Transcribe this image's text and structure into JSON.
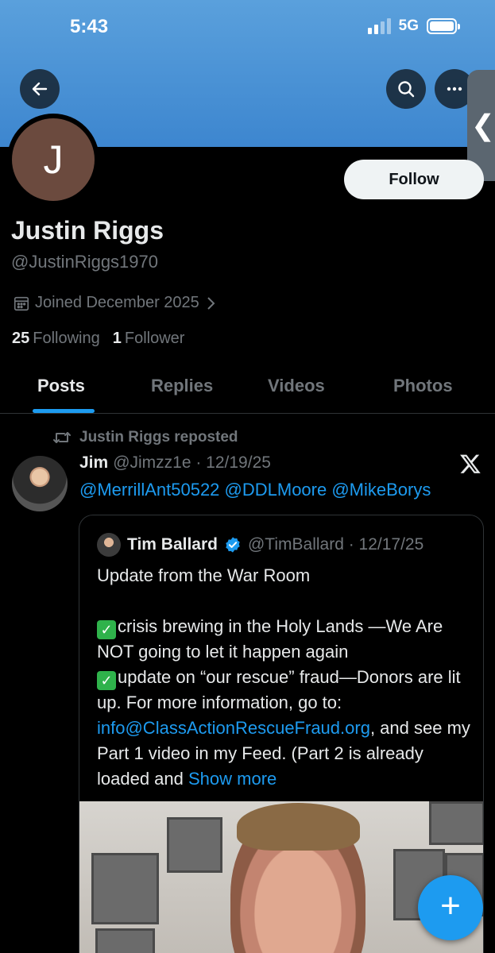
{
  "status_bar": {
    "time": "5:43",
    "network": "5G"
  },
  "header": {
    "back_icon": "arrow-left-icon",
    "search_icon": "search-icon",
    "more_icon": "more-horizontal-icon",
    "side_tab_glyph": "❮"
  },
  "profile": {
    "avatar_letter": "J",
    "follow_label": "Follow",
    "name": "Justin Riggs",
    "handle": "@JustinRiggs1970",
    "joined": "Joined December 2025",
    "following_count": "25",
    "following_label": "Following",
    "followers_count": "1",
    "followers_label": "Follower"
  },
  "tabs": [
    "Posts",
    "Replies",
    "Videos",
    "Photos"
  ],
  "post": {
    "repost_label": "Justin Riggs reposted",
    "author_name": "Jim",
    "author_meta": "@Jimzz1e · 12/19/25",
    "mentions": "@MerrillAnt50522 @DDLMoore @MikeBorys",
    "quote": {
      "author_name": "Tim Ballard",
      "author_meta": "@TimBallard · 12/17/25",
      "line1": "Update from the War Room",
      "line2": "crisis brewing in the Holy Lands —We Are NOT going to let it happen again",
      "line3": "update on “our rescue” fraud—Donors are lit up. For more information, go to: ",
      "email": "info@ClassActionRescueFraud.org",
      "line3_after": ", and see my Part 1 video in my Feed. (Part 2 is already loaded and ",
      "show_more": "Show more"
    }
  },
  "fab": {
    "icon": "plus-icon",
    "glyph": "+"
  },
  "colors": {
    "accent": "#1d9bf0",
    "banner": "#4a92d6",
    "background": "#000000",
    "muted": "#71767b"
  }
}
